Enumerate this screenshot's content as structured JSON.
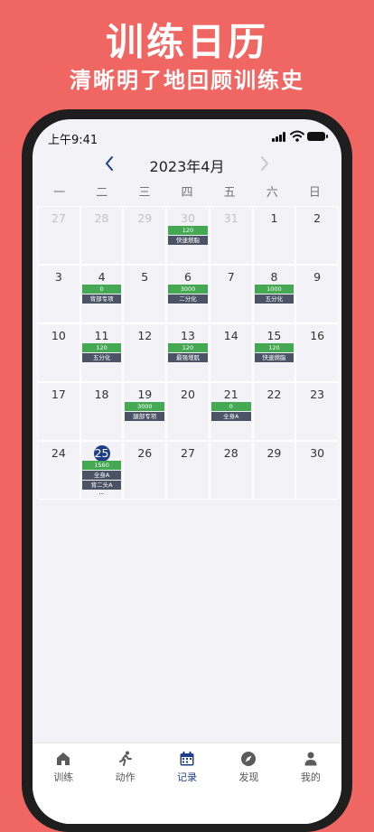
{
  "promo": {
    "title": "训练日历",
    "subtitle": "清晰明了地回顾训练史"
  },
  "status_bar": {
    "time": "上午9:41"
  },
  "calendar": {
    "month_title": "2023年4月",
    "weekdays": [
      "一",
      "二",
      "三",
      "四",
      "五",
      "六",
      "日"
    ],
    "days": [
      {
        "num": "27",
        "other": true,
        "events": []
      },
      {
        "num": "28",
        "other": true,
        "events": []
      },
      {
        "num": "29",
        "other": true,
        "events": []
      },
      {
        "num": "30",
        "other": true,
        "events": [
          {
            "type": "green",
            "text": "120"
          },
          {
            "type": "dark",
            "text": "快速燃脂"
          }
        ]
      },
      {
        "num": "31",
        "other": true,
        "events": []
      },
      {
        "num": "1",
        "events": []
      },
      {
        "num": "2",
        "events": []
      },
      {
        "num": "3",
        "events": []
      },
      {
        "num": "4",
        "events": [
          {
            "type": "green",
            "text": "0"
          },
          {
            "type": "dark",
            "text": "背部专项"
          }
        ]
      },
      {
        "num": "5",
        "events": []
      },
      {
        "num": "6",
        "events": [
          {
            "type": "green",
            "text": "3000"
          },
          {
            "type": "dark",
            "text": "二分化"
          }
        ]
      },
      {
        "num": "7",
        "events": []
      },
      {
        "num": "8",
        "events": [
          {
            "type": "green",
            "text": "1000"
          },
          {
            "type": "dark",
            "text": "五分化"
          }
        ]
      },
      {
        "num": "9",
        "events": []
      },
      {
        "num": "10",
        "events": []
      },
      {
        "num": "11",
        "events": [
          {
            "type": "green",
            "text": "120"
          },
          {
            "type": "dark",
            "text": "五分化"
          }
        ]
      },
      {
        "num": "12",
        "events": []
      },
      {
        "num": "13",
        "events": [
          {
            "type": "green",
            "text": "120"
          },
          {
            "type": "dark",
            "text": "最强增肌"
          }
        ]
      },
      {
        "num": "14",
        "events": []
      },
      {
        "num": "15",
        "events": [
          {
            "type": "green",
            "text": "120"
          },
          {
            "type": "dark",
            "text": "快速燃脂"
          }
        ]
      },
      {
        "num": "16",
        "events": []
      },
      {
        "num": "17",
        "events": []
      },
      {
        "num": "18",
        "events": []
      },
      {
        "num": "19",
        "events": [
          {
            "type": "green",
            "text": "3000"
          },
          {
            "type": "dark",
            "text": "腿部专项"
          }
        ]
      },
      {
        "num": "20",
        "events": []
      },
      {
        "num": "21",
        "events": [
          {
            "type": "green",
            "text": "0"
          },
          {
            "type": "dark",
            "text": "全身A"
          }
        ]
      },
      {
        "num": "22",
        "events": []
      },
      {
        "num": "23",
        "events": []
      },
      {
        "num": "24",
        "events": []
      },
      {
        "num": "25",
        "today": true,
        "events": [
          {
            "type": "green",
            "text": "1560"
          },
          {
            "type": "dark",
            "text": "全身A"
          },
          {
            "type": "dark",
            "text": "背二头A"
          },
          {
            "type": "more",
            "text": "..."
          }
        ]
      },
      {
        "num": "26",
        "events": []
      },
      {
        "num": "27",
        "events": []
      },
      {
        "num": "28",
        "events": []
      },
      {
        "num": "29",
        "events": []
      },
      {
        "num": "30",
        "events": []
      }
    ]
  },
  "tabbar": {
    "tabs": [
      {
        "label": "训练",
        "icon": "home-icon",
        "active": false
      },
      {
        "label": "动作",
        "icon": "running-icon",
        "active": false
      },
      {
        "label": "记录",
        "icon": "calendar-icon",
        "active": true
      },
      {
        "label": "发现",
        "icon": "compass-icon",
        "active": false
      },
      {
        "label": "我的",
        "icon": "profile-icon",
        "active": false
      }
    ]
  },
  "colors": {
    "background": "#ef6663",
    "accent": "#1d3f8a",
    "event_green": "#45a853",
    "event_dark": "#4b5465"
  }
}
